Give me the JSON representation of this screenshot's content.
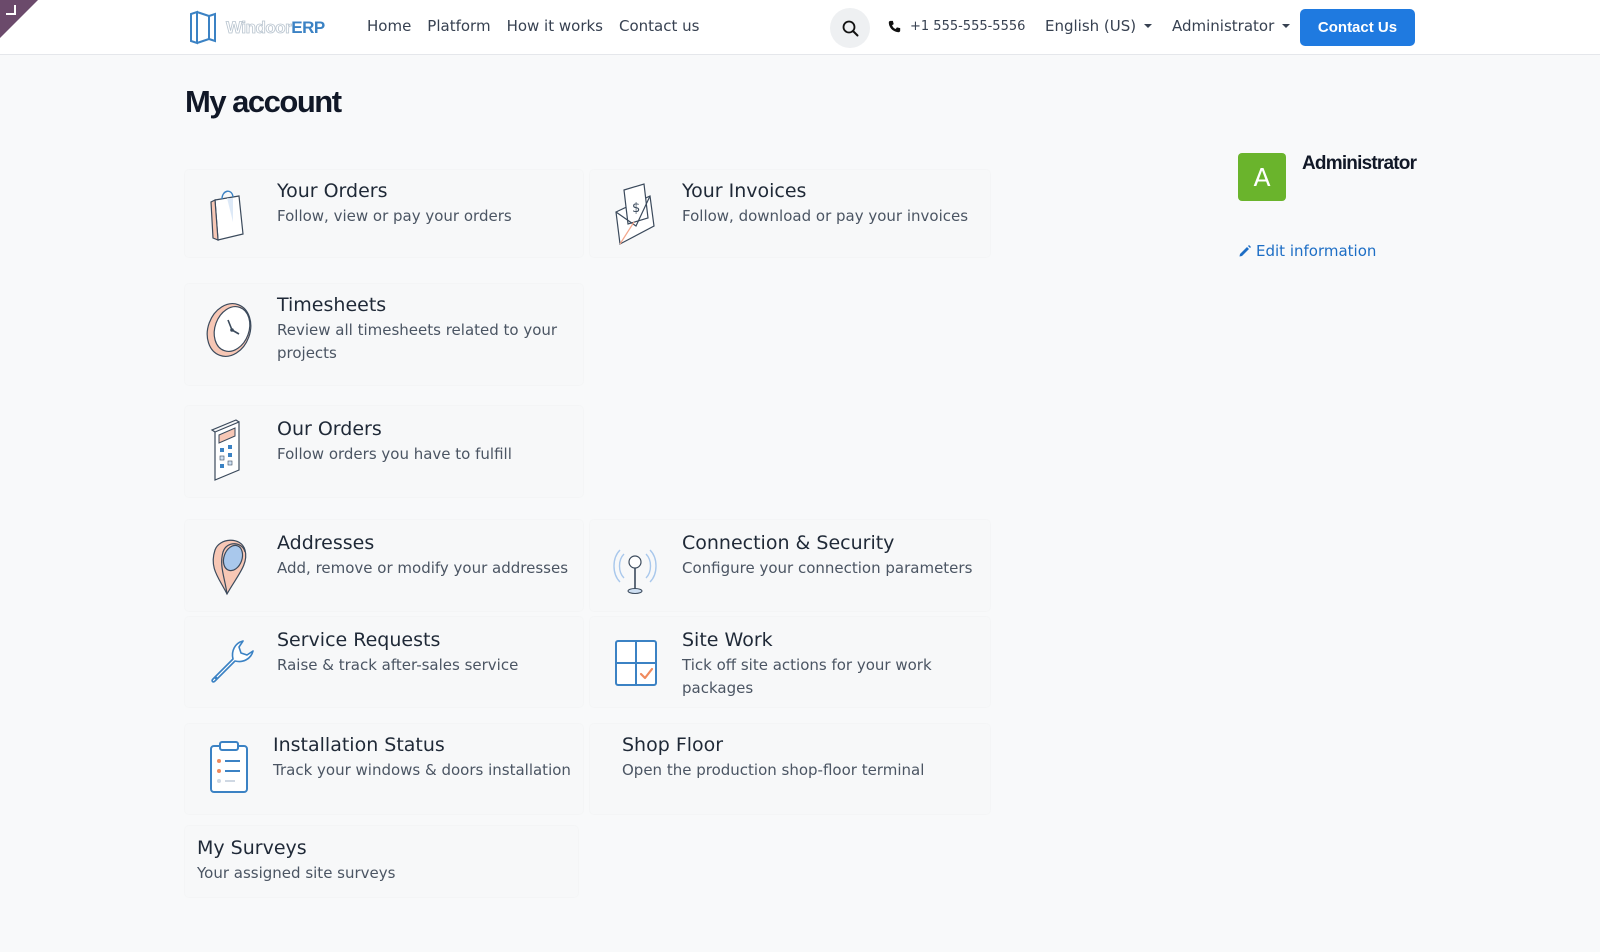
{
  "header": {
    "logo": {
      "part1": "Windoor",
      "part2": "ERP"
    },
    "nav": [
      "Home",
      "Platform",
      "How it works",
      "Contact us"
    ],
    "phone": "+1 555-555-5556",
    "language": "English (US)",
    "user": "Administrator",
    "cta": "Contact Us"
  },
  "page_title": "My account",
  "cards": [
    {
      "title": "Your Orders",
      "desc": "Follow, view or pay your orders",
      "icon": "shopping-bag-icon"
    },
    {
      "title": "Your Invoices",
      "desc": "Follow, download or pay your invoices",
      "icon": "invoice-envelope-icon"
    },
    {
      "title": "Timesheets",
      "desc": "Review all timesheets related to your projects",
      "icon": "clock-icon"
    },
    {
      "title": "Our Orders",
      "desc": "Follow orders you have to fulfill",
      "icon": "calculator-icon"
    },
    {
      "title": "Addresses",
      "desc": "Add, remove or modify your addresses",
      "icon": "map-pin-icon"
    },
    {
      "title": "Connection & Security",
      "desc": "Configure your connection parameters",
      "icon": "antenna-icon"
    },
    {
      "title": "Service Requests",
      "desc": "Raise & track after-sales service",
      "icon": "wrench-icon"
    },
    {
      "title": "Site Work",
      "desc": "Tick off site actions for your work packages",
      "icon": "window-check-icon"
    },
    {
      "title": "Installation Status",
      "desc": "Track your windows & doors installation",
      "icon": "clipboard-list-icon"
    },
    {
      "title": "Shop Floor",
      "desc": "Open the production shop-floor terminal"
    },
    {
      "title": "My Surveys",
      "desc": "Your assigned site surveys"
    }
  ],
  "sidebar": {
    "avatar_letter": "A",
    "name": "Administrator",
    "edit_label": "Edit information"
  },
  "colors": {
    "primary": "#1f7ae0",
    "avatar": "#6ab42c",
    "link": "#1d6ec5"
  }
}
